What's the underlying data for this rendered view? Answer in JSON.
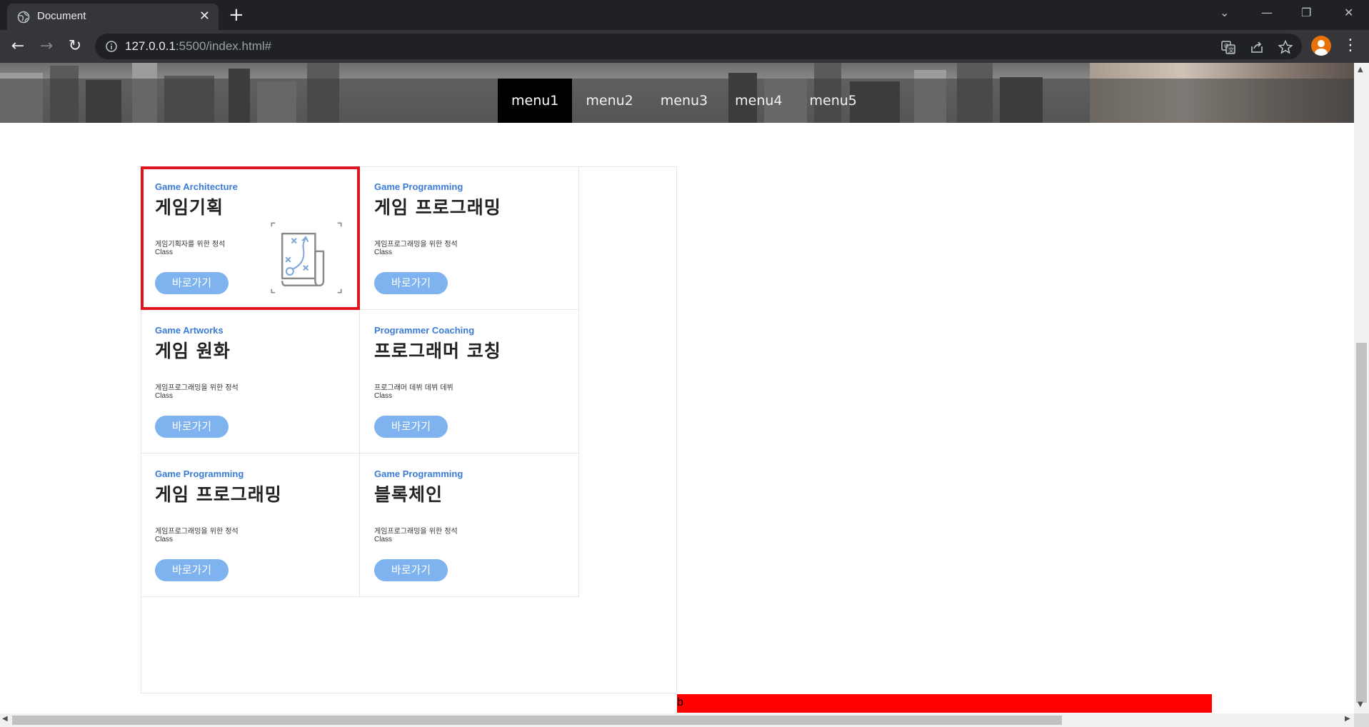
{
  "browser": {
    "tab_title": "Document",
    "tab_close": "✕",
    "new_tab": "+",
    "url_host": "127.0.0.1",
    "url_rest": ":5500/index.html#",
    "back": "←",
    "forward": "→",
    "reload": "↻",
    "menu": "⋮",
    "win_dropdown": "⌄",
    "win_minimize": "—",
    "win_restore": "❐",
    "win_close": "✕"
  },
  "nav": {
    "items": [
      {
        "label": "menu1",
        "active": true
      },
      {
        "label": "menu2",
        "active": false
      },
      {
        "label": "menu3",
        "active": false
      },
      {
        "label": "menu4",
        "active": false
      },
      {
        "label": "menu5",
        "active": false
      }
    ]
  },
  "cards": [
    {
      "subtitle": "Game Architecture",
      "title": "게임기획",
      "desc": "게임기획자를 위한 정석",
      "class_label": "Class",
      "button": "바로가기",
      "selected": true,
      "icon": "strategy-map-icon"
    },
    {
      "subtitle": "Game Programming",
      "title": "게임 프로그래밍",
      "desc": "게임프로그래밍을 위한 정석",
      "class_label": "Class",
      "button": "바로가기",
      "selected": false
    },
    {
      "subtitle": "Game Artworks",
      "title": "게임 원화",
      "desc": "게임프로그래밍을 위한 정석",
      "class_label": "Class",
      "button": "바로가기",
      "selected": false
    },
    {
      "subtitle": "Programmer Coaching",
      "title": "프로그래머 코칭",
      "desc": "프로그래머 데뷔 데뷔 데뷔",
      "class_label": "Class",
      "button": "바로가기",
      "selected": false
    },
    {
      "subtitle": "Game Programming",
      "title": "게임 프로그래밍",
      "desc": "게임프로그래밍을 위한 정석",
      "class_label": "Class",
      "button": "바로가기",
      "selected": false
    },
    {
      "subtitle": "Game Programming",
      "title": "블록체인",
      "desc": "게임프로그래밍을 위한 정석",
      "class_label": "Class",
      "button": "바로가기",
      "selected": false
    }
  ],
  "footer_bar": {
    "text": "b",
    "color": "#ff0000"
  },
  "colors": {
    "accent_blue": "#3a7bd5",
    "button_blue": "#7fb3ef",
    "selection_red": "#e0141e",
    "chrome_dark": "#202124",
    "chrome_toolbar": "#35363a"
  }
}
